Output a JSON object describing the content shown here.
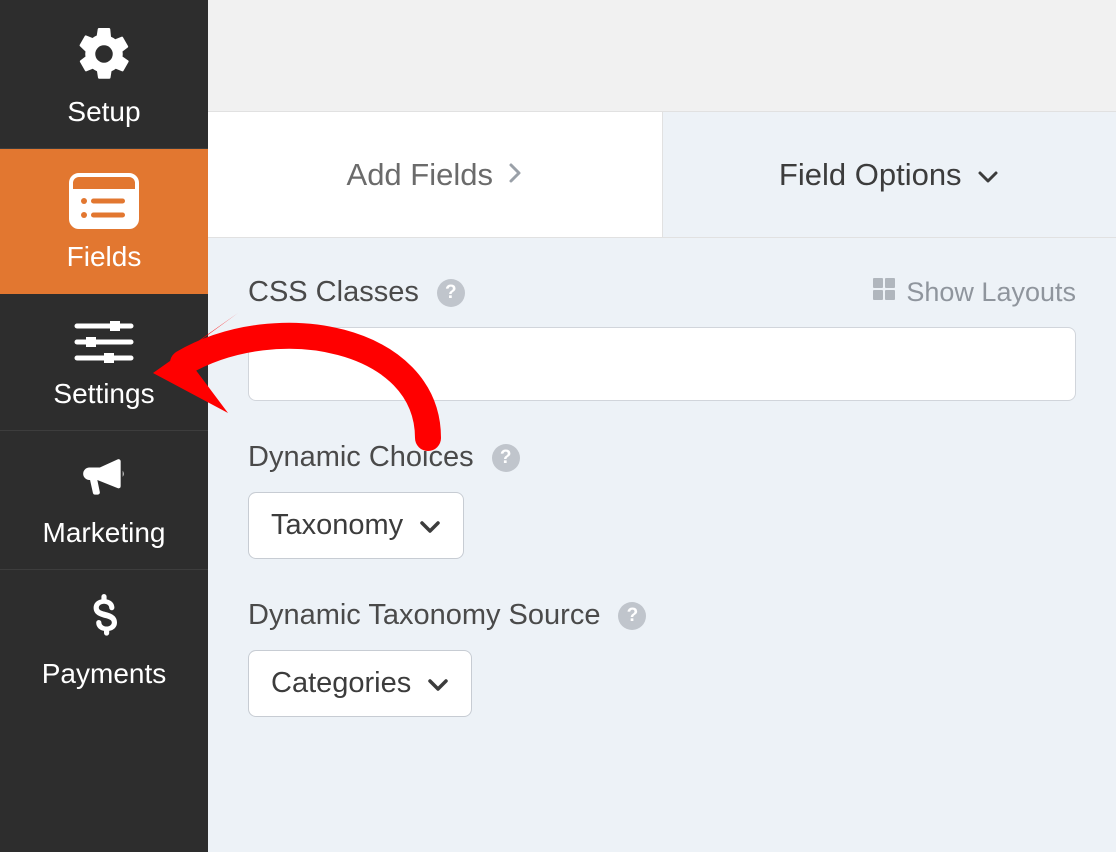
{
  "sidebar": {
    "items": [
      {
        "label": "Setup"
      },
      {
        "label": "Fields"
      },
      {
        "label": "Settings"
      },
      {
        "label": "Marketing"
      },
      {
        "label": "Payments"
      }
    ]
  },
  "tabs": {
    "add_fields": "Add Fields",
    "field_options": "Field Options"
  },
  "panel": {
    "css_classes_label": "CSS Classes",
    "css_classes_value": "",
    "show_layouts": "Show Layouts",
    "dynamic_choices_label": "Dynamic Choices",
    "dynamic_choices_value": "Taxonomy",
    "dynamic_taxonomy_source_label": "Dynamic Taxonomy Source",
    "dynamic_taxonomy_source_value": "Categories"
  }
}
